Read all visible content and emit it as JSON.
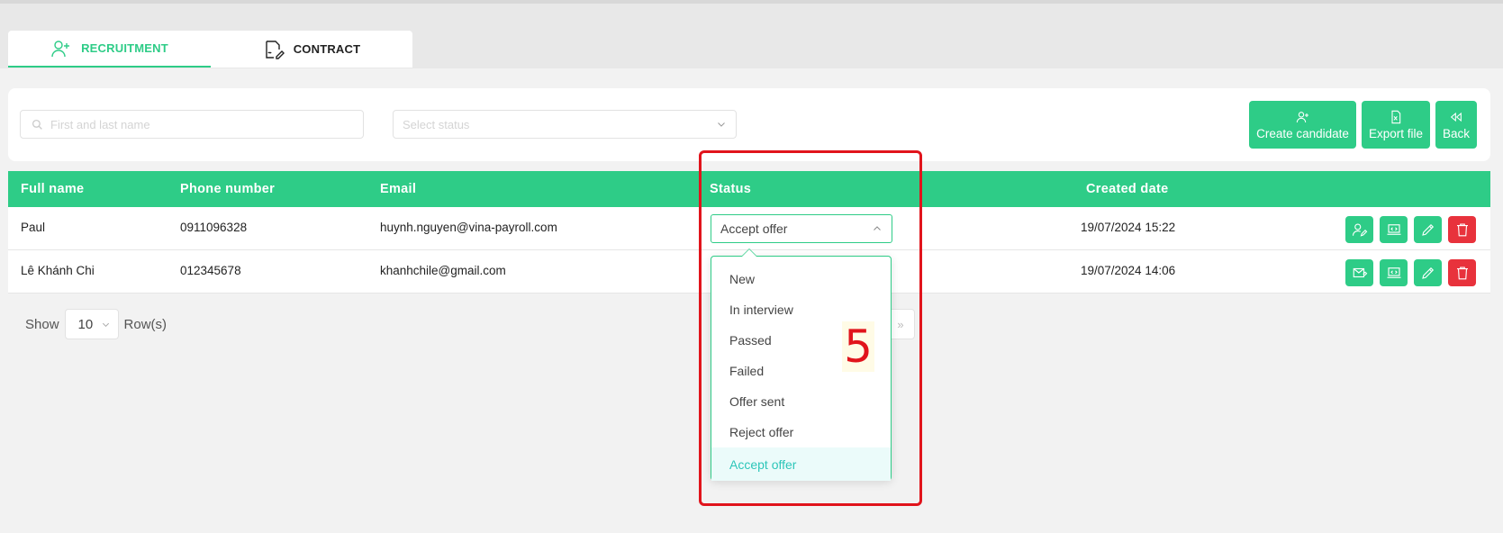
{
  "tabs": [
    {
      "label": "RECRUITMENT",
      "icon": "user-plus-icon",
      "active": true
    },
    {
      "label": "CONTRACT",
      "icon": "contract-sign-icon",
      "active": false
    }
  ],
  "filters": {
    "search_placeholder": "First and last name",
    "status_placeholder": "Select status"
  },
  "actions": {
    "create_candidate": "Create candidate",
    "export_file": "Export file",
    "back": "Back"
  },
  "table": {
    "headers": {
      "full_name": "Full name",
      "phone": "Phone number",
      "email": "Email",
      "status": "Status",
      "created": "Created date"
    },
    "rows": [
      {
        "full_name": "Paul",
        "phone": "0911096328",
        "email": "huynh.nguyen@vina-payroll.com",
        "status": "Accept offer",
        "created": "19/07/2024 15:22"
      },
      {
        "full_name": "Lê Khánh Chi",
        "phone": "012345678",
        "email": "khanhchile@gmail.com",
        "status": "",
        "created": "19/07/2024 14:06"
      }
    ]
  },
  "pagination": {
    "show_label": "Show",
    "rows_value": "10",
    "rows_label": "Row(s)",
    "next_symbol": "»"
  },
  "status_dropdown": {
    "options": [
      "New",
      "In interview",
      "Passed",
      "Failed",
      "Offer sent",
      "Reject offer",
      "Accept offer"
    ],
    "selected": "Accept offer"
  },
  "annotation": {
    "step_number": "5"
  },
  "colors": {
    "accent": "#2ecc87",
    "danger": "#e8323c",
    "highlight": "#e1141c",
    "selected_text": "#2dc6b9"
  }
}
